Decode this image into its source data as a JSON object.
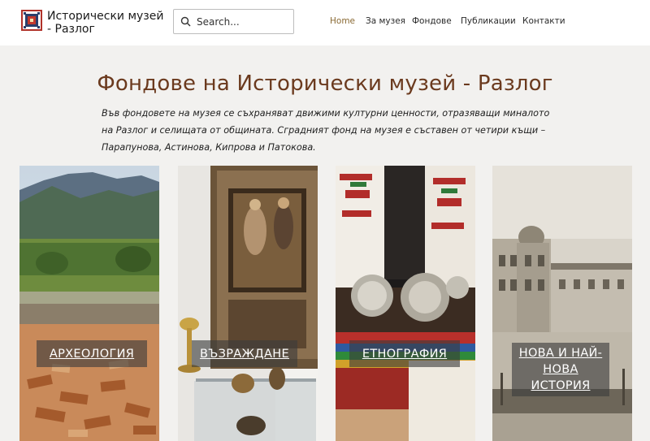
{
  "header": {
    "site_title": "Исторически музей - Разлог",
    "search_placeholder": "Search...",
    "nav": [
      {
        "label": "Home",
        "active": true
      },
      {
        "label": "За музея",
        "active": false
      },
      {
        "label": "Фондове",
        "active": false
      },
      {
        "label": "Публикации",
        "active": false
      },
      {
        "label": "Контакти",
        "active": false
      }
    ]
  },
  "main": {
    "heading": "Фондове на Исторически музей - Разлог",
    "intro": "Във фондовете на музея се съхраняват движими културни ценности, отразяващи миналото на Разлог и селищата от общината. Сградният фонд на музея е съставен от четири къщи – Парапунова, Астинова, Кипрова и Патокова.",
    "cards": [
      {
        "label": "АРХЕОЛОГИЯ",
        "image": "mountain-landscape-ruins"
      },
      {
        "label": "ВЪЗРАЖДАНЕ",
        "image": "icon-and-church-objects"
      },
      {
        "label": "ЕТНОГРАФИЯ",
        "image": "folk-costume-silver-buckle"
      },
      {
        "label": "НОВА И НАЙ-НОВА ИСТОРИЯ",
        "image": "old-town-photograph"
      }
    ]
  },
  "colors": {
    "heading": "#6b3a1e",
    "nav_active": "#8a6a34",
    "background": "#f2f1ef"
  }
}
